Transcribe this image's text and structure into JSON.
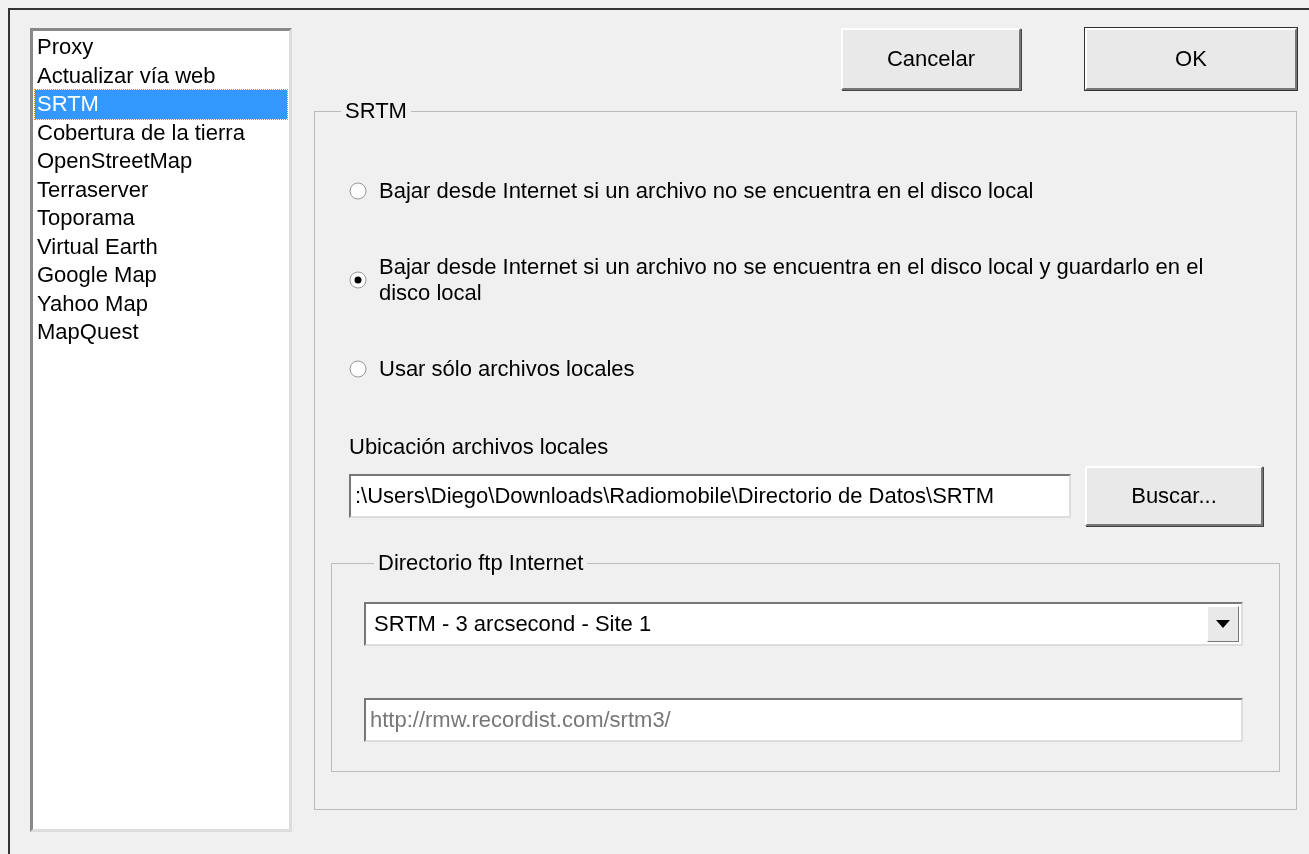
{
  "sidebar": {
    "items": [
      {
        "label": "Proxy",
        "selected": false
      },
      {
        "label": "Actualizar vía web",
        "selected": false
      },
      {
        "label": "SRTM",
        "selected": true
      },
      {
        "label": "Cobertura de la tierra",
        "selected": false
      },
      {
        "label": "OpenStreetMap",
        "selected": false
      },
      {
        "label": "Terraserver",
        "selected": false
      },
      {
        "label": "Toporama",
        "selected": false
      },
      {
        "label": "Virtual Earth",
        "selected": false
      },
      {
        "label": "Google Map",
        "selected": false
      },
      {
        "label": "Yahoo Map",
        "selected": false
      },
      {
        "label": "MapQuest",
        "selected": false
      }
    ]
  },
  "buttons": [
    "Cancelar",
    "OK"
  ],
  "group": {
    "title": "SRTM",
    "options": [
      {
        "label": "Bajar desde Internet si un archivo no se encuentra en el disco local",
        "selected": false
      },
      {
        "label": "Bajar desde Internet si un archivo no se encuentra en el disco local y guardarlo en el disco local",
        "selected": true
      },
      {
        "label": "Usar sólo archivos locales",
        "selected": false
      }
    ],
    "path_label": "Ubicación archivos locales",
    "path_value": ":\\Users\\Diego\\Downloads\\Radiomobile\\Directorio de Datos\\SRTM",
    "browse_button": "Buscar...",
    "ftp": {
      "title": "Directorio ftp Internet",
      "server": "SRTM - 3 arcsecond - Site 1",
      "url": "http://rmw.recordist.com/srtm3/",
      "url_disabled": true
    }
  }
}
